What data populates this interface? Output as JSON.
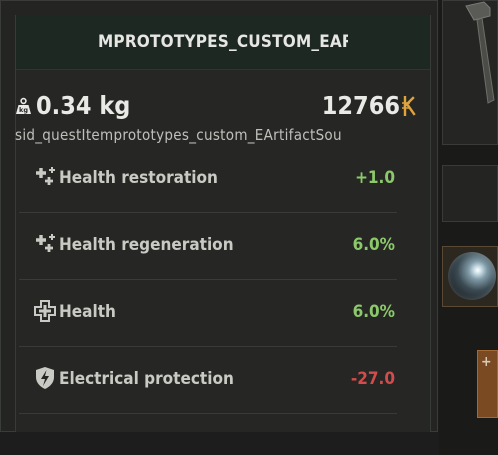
{
  "tooltip": {
    "title": "MPROTOTYPES_CUSTOM_EARTIFAC",
    "weight": "0.34 kg",
    "price": "12766",
    "sid": "sid_questItemprototypes_custom_EArtifactSou",
    "stats": [
      {
        "label": "Health restoration",
        "value": "+1.0",
        "icon": "sparkle-plus-icon",
        "polarity": "positive"
      },
      {
        "label": "Health regeneration",
        "value": "6.0%",
        "icon": "sparkle-plus-icon",
        "polarity": "positive"
      },
      {
        "label": "Health",
        "value": "6.0%",
        "icon": "medical-cross-icon",
        "polarity": "positive"
      },
      {
        "label": "Electrical protection",
        "value": "-27.0",
        "icon": "lightning-shield-icon",
        "polarity": "negative"
      }
    ]
  },
  "colors": {
    "positive": "#8cc96a",
    "negative": "#d24c4c",
    "currency": "#e0a23a"
  },
  "side_panel": {
    "slot_icons": [
      "tool-icon",
      "artifact-orb-icon",
      "medkit-icon"
    ],
    "medkit_symbol": "+"
  }
}
